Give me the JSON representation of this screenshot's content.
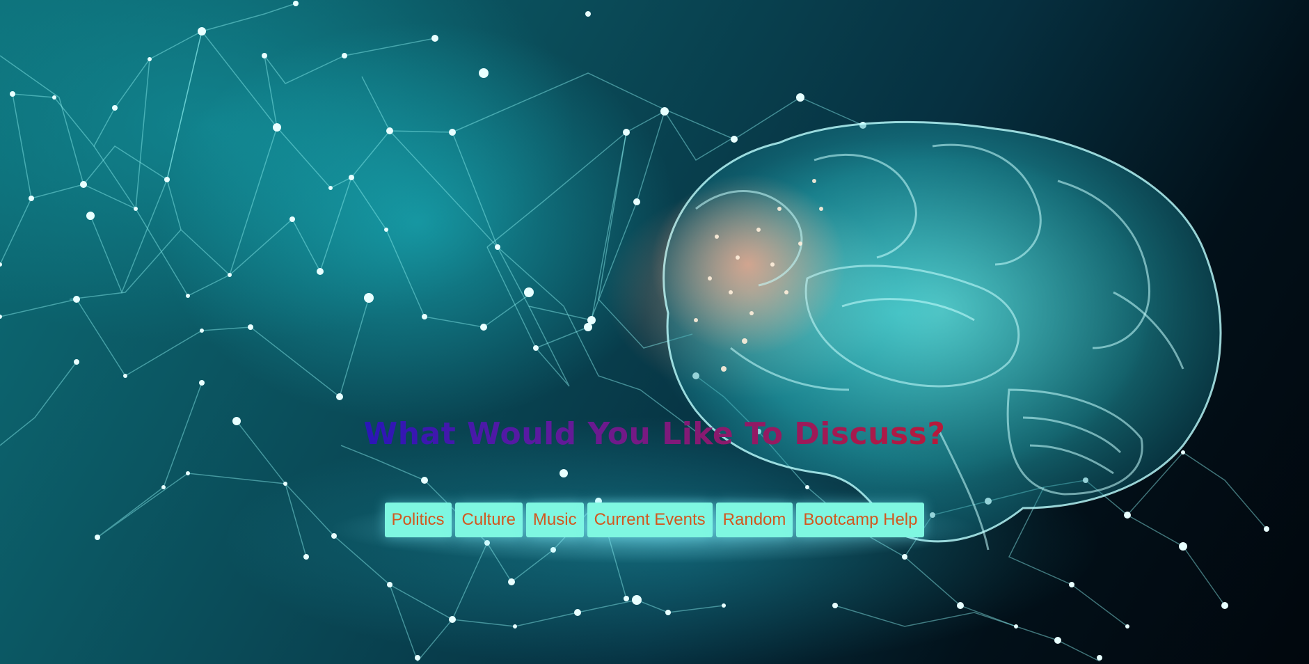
{
  "main": {
    "heading": "What Would You Like To Discuss?",
    "topics": [
      {
        "label": "Politics"
      },
      {
        "label": "Culture"
      },
      {
        "label": "Music"
      },
      {
        "label": "Current Events"
      },
      {
        "label": "Random"
      },
      {
        "label": "Bootcamp Help"
      }
    ]
  },
  "theme": {
    "heading_gradient_start": "#2a16b8",
    "heading_gradient_end": "#b81a3a",
    "button_background": "#7ff7e1",
    "button_text": "#d2571f",
    "background_image": "glowing-brain-neural-network"
  }
}
